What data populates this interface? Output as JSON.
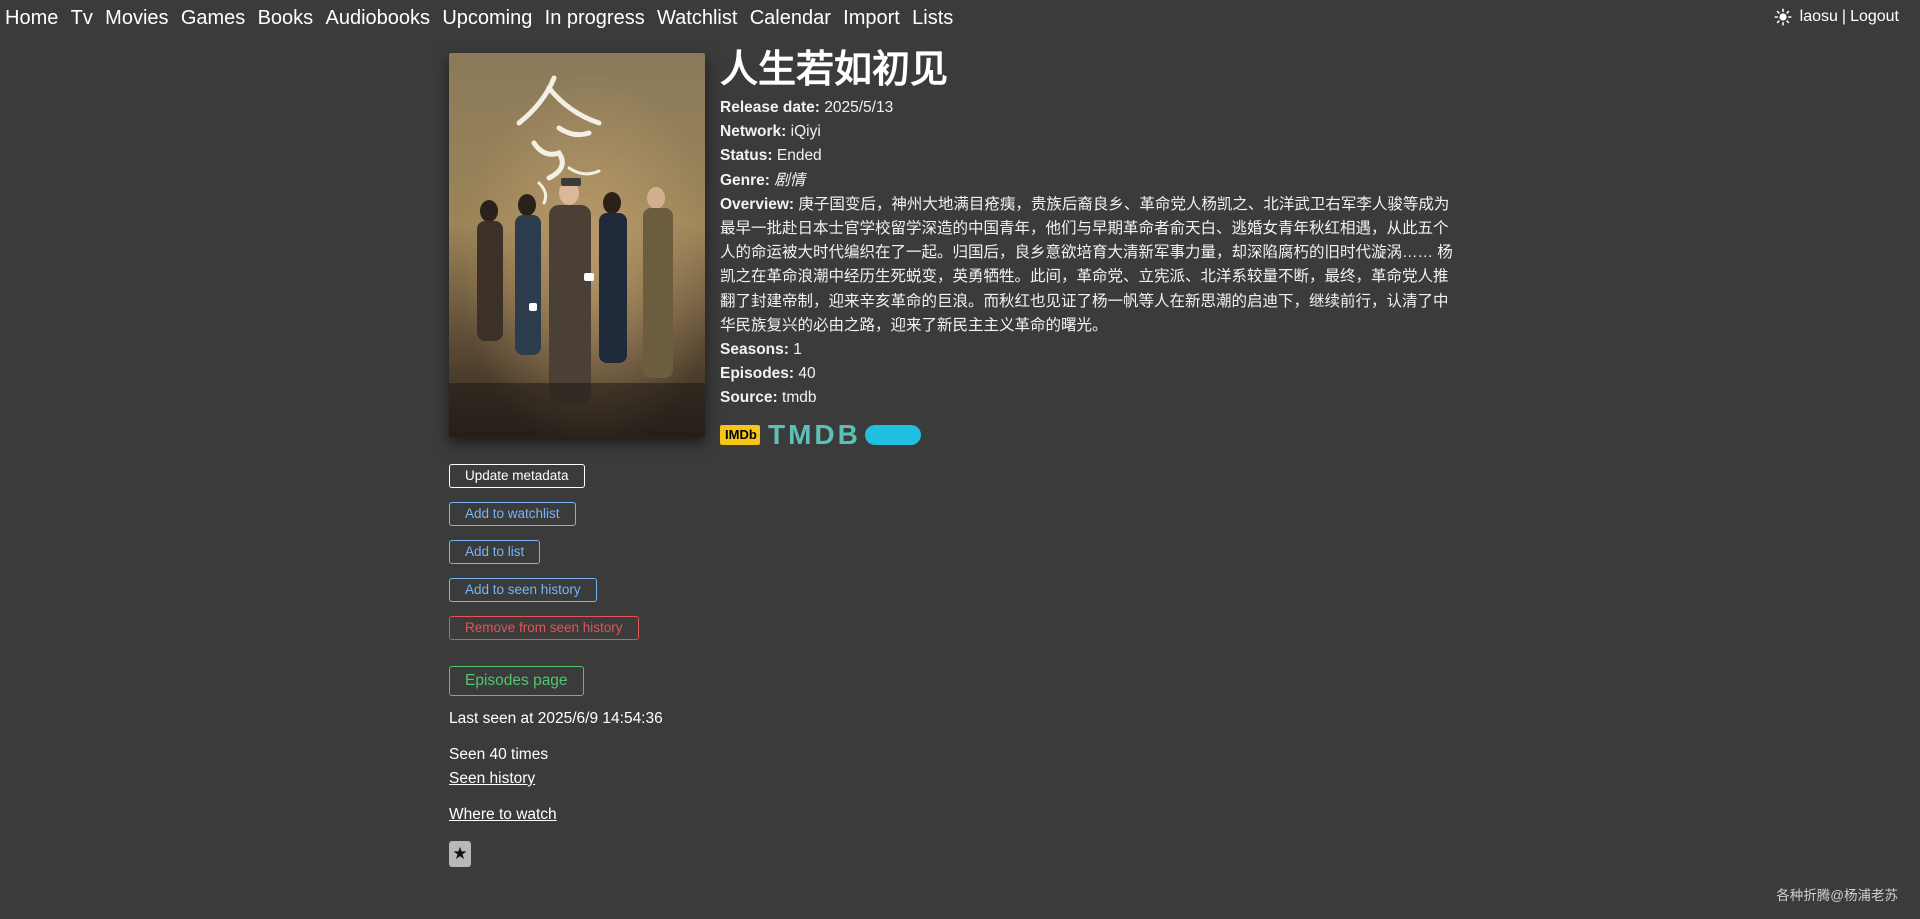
{
  "nav": {
    "links": [
      "Home",
      "Tv",
      "Movies",
      "Games",
      "Books",
      "Audiobooks",
      "Upcoming",
      "In progress",
      "Watchlist",
      "Calendar",
      "Import",
      "Lists"
    ],
    "username": "laosu",
    "separator": "|",
    "logout": "Logout"
  },
  "show": {
    "title": "人生若如初见",
    "release_label": "Release date:",
    "release_value": "2025/5/13",
    "network_label": "Network:",
    "network_value": "iQiyi",
    "status_label": "Status:",
    "status_value": "Ended",
    "genre_label": "Genre:",
    "genre_value": "剧情",
    "overview_label": "Overview:",
    "overview_value": "庚子国变后，神州大地满目疮痍，贵族后裔良乡、革命党人杨凯之、北洋武卫右军李人骏等成为最早一批赴日本士官学校留学深造的中国青年，他们与早期革命者俞天白、逃婚女青年秋红相遇，从此五个人的命运被大时代编织在了一起。归国后，良乡意欲培育大清新军事力量，却深陷腐朽的旧时代漩涡…… 杨凯之在革命浪潮中经历生死蜕变，英勇牺牲。此间，革命党、立宪派、北洋系较量不断，最终，革命党人推翻了封建帝制，迎来辛亥革命的巨浪。而秋红也见证了杨一帆等人在新思潮的启迪下，继续前行，认清了中华民族复兴的必由之路，迎来了新民主主义革命的曙光。",
    "seasons_label": "Seasons:",
    "seasons_value": "1",
    "episodes_label": "Episodes:",
    "episodes_value": "40",
    "source_label": "Source:",
    "source_value": "tmdb",
    "imdb_logo": "IMDb",
    "tmdb_logo": "TMDB"
  },
  "actions": {
    "update_metadata": "Update metadata",
    "add_watchlist": "Add to watchlist",
    "add_list": "Add to list",
    "add_seen": "Add to seen history",
    "remove_seen": "Remove from seen history",
    "episodes_page": "Episodes page"
  },
  "history": {
    "last_seen": "Last seen at 2025/6/9 14:54:36",
    "seen_times": "Seen 40 times",
    "seen_history_link": "Seen history",
    "where_to_watch": "Where to watch",
    "star_icon": "★"
  },
  "footer": "各种折腾@杨浦老苏",
  "colors": {
    "background": "#3b3b3b",
    "link_blue": "#7ab3f3",
    "danger_red": "#e25555",
    "success_green": "#52c46e",
    "imdb_yellow": "#f5c518",
    "tmdb_teal": "#5dc0b4",
    "tmdb_blue": "#1fc0e2"
  }
}
